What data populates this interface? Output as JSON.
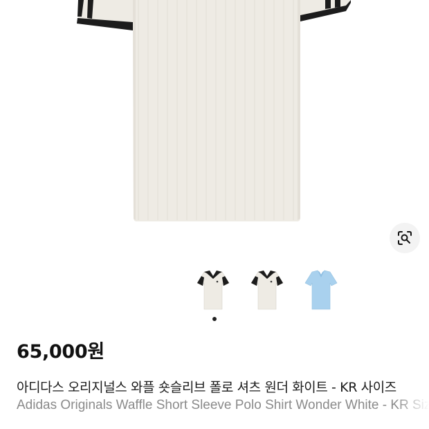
{
  "product": {
    "price": "65,000원",
    "title_ko": "아디다스 오리지널스 와플 숏슬리브 폴로 셔츠 원더 화이트 - KR 사이즈",
    "title_en": "Adidas Originals Waffle Short Sleeve Polo Shirt Wonder White - KR Size"
  },
  "gallery": {
    "main_image": "polo-shirt-image",
    "thumbnails": [
      {
        "name": "polo-white-front"
      },
      {
        "name": "polo-white-alt"
      },
      {
        "name": "polo-light-blue"
      }
    ],
    "active_index": 0
  },
  "icons": {
    "lens": "visual-search-icon"
  },
  "colors": {
    "shirt_cream": "#eeebe4",
    "trim_black": "#1c1c1c",
    "shirt_blue": "#a9d1ee",
    "lens_bg": "#f3f3f3",
    "text_primary": "#111111",
    "text_secondary": "#8a8a8a"
  }
}
